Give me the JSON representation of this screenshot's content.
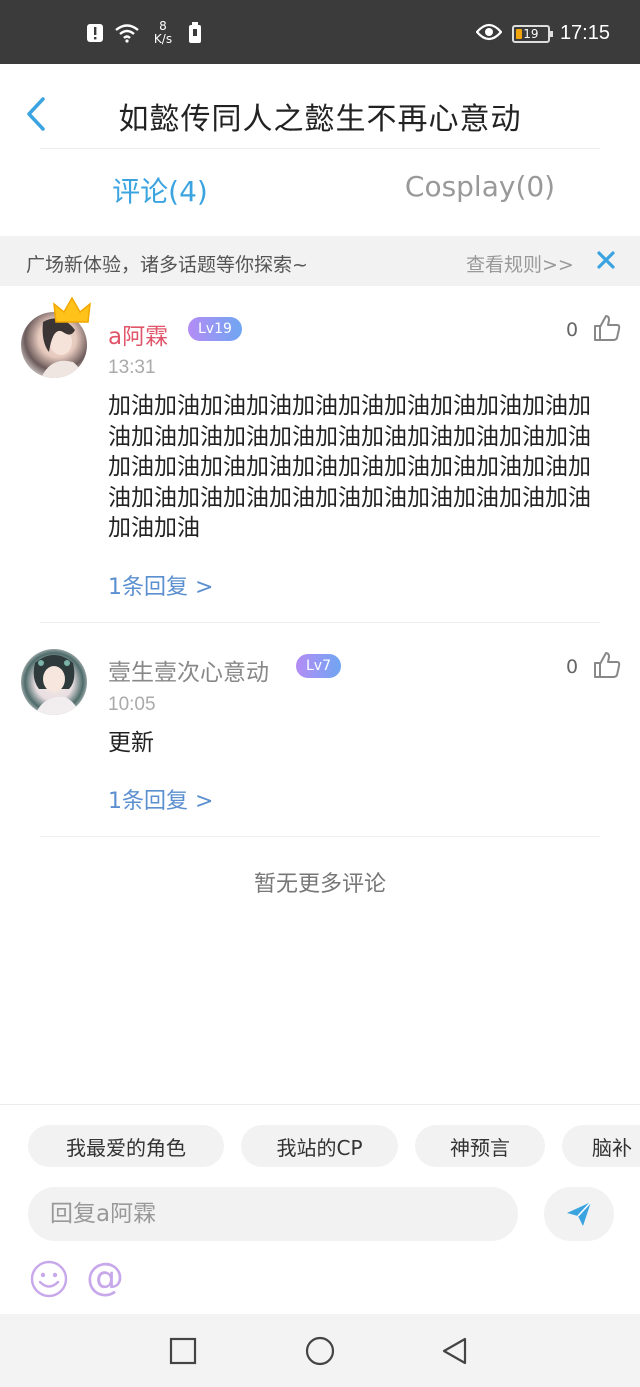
{
  "status_bar": {
    "speed_value": "8",
    "speed_unit": "K/s",
    "battery": "19",
    "time": "17:15"
  },
  "header": {
    "title": "如懿传同人之懿生不再心意动"
  },
  "tabs": [
    {
      "label": "评论(4)",
      "active": true
    },
    {
      "label": "Cosplay(0)",
      "active": false
    }
  ],
  "notice": {
    "text": "广场新体验，诸多话题等你探索~",
    "rules_link": "查看规则>>"
  },
  "comments": [
    {
      "username": "a阿霖",
      "level": "Lv19",
      "likes": "0",
      "time": "13:31",
      "body": "加油加油加油加油加油加油加油加油加油加油加油加油加油加油加油加油加油加油加油加油加油加油加油加油加油加油加油加油加油加油加油加油加油加油加油加油加油加油加油加油加油加油加油加油",
      "reply_link": "1条回复 >",
      "username_color": "#e0556a"
    },
    {
      "username": "壹生壹次心意动",
      "level": "Lv7",
      "likes": "0",
      "time": "10:05",
      "body": "更新",
      "reply_link": "1条回复 >",
      "username_color": "#888888"
    }
  ],
  "footer_text": "暂无更多评论",
  "chips": [
    "我最爱的角色",
    "我站的CP",
    "神预言",
    "脑补"
  ],
  "input": {
    "placeholder": "回复a阿霖"
  },
  "colors": {
    "accent": "#3ba4e0",
    "link": "#5b8fd0",
    "level_gradient_start": "#b48cf5",
    "level_gradient_end": "#6fa6f2"
  }
}
